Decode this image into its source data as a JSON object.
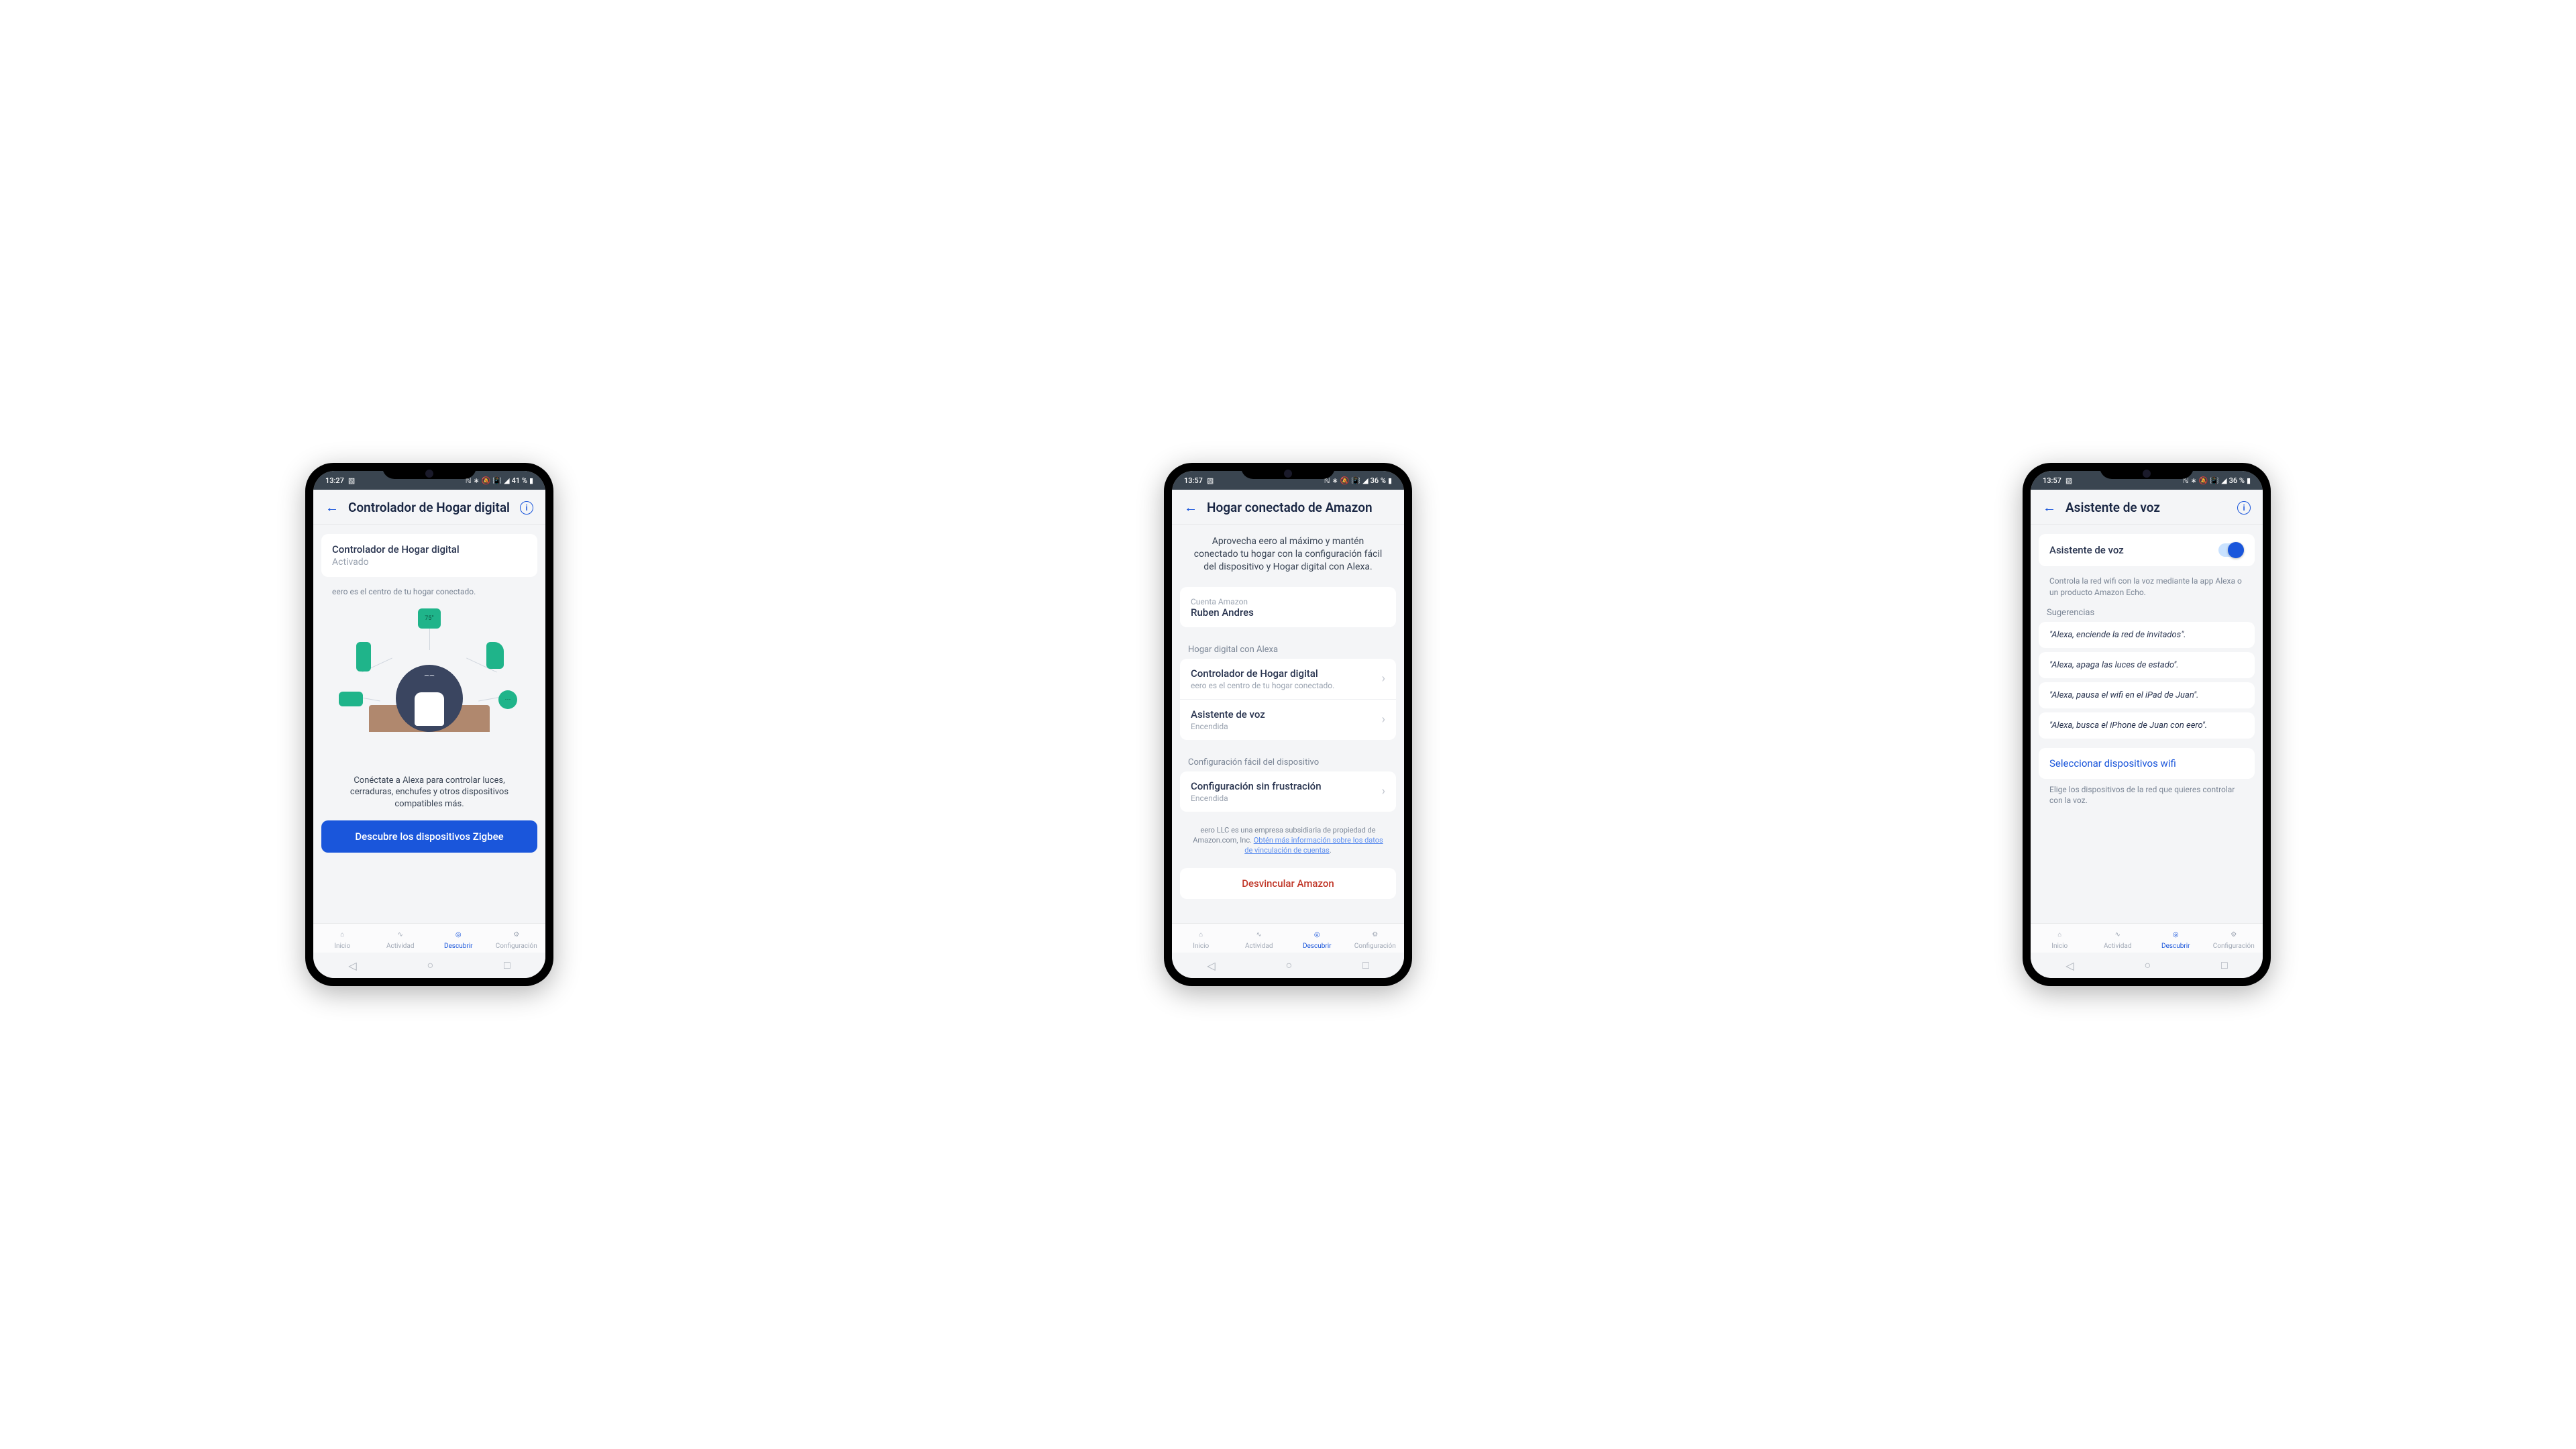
{
  "status": {
    "time1": "13:27",
    "time2": "13:57",
    "time3": "13:57",
    "battery1": "41 %",
    "battery2": "36 %",
    "battery3": "36 %"
  },
  "nav": {
    "inicio": "Inicio",
    "actividad": "Actividad",
    "descubrir": "Descubrir",
    "configuracion": "Configuración"
  },
  "phone1": {
    "title": "Controlador de Hogar digital",
    "card_title": "Controlador de Hogar digital",
    "card_sub": "Activado",
    "helper": "eero es el centro de tu hogar conectado.",
    "illu_temp": "75°",
    "desc": "Conéctate a Alexa para controlar luces, cerraduras, enchufes y otros dispositivos compatibles más.",
    "cta": "Descubre los dispositivos Zigbee"
  },
  "phone2": {
    "title": "Hogar conectado de Amazon",
    "intro": "Aprovecha eero al máximo y mantén conectado tu hogar con la configuración fácil del dispositivo y Hogar digital con Alexa.",
    "account_label": "Cuenta Amazon",
    "account_name": "Ruben Andres",
    "section_alexa": "Hogar digital con Alexa",
    "item1_title": "Controlador de Hogar digital",
    "item1_sub": "eero es el centro de tu hogar conectado.",
    "item2_title": "Asistente de voz",
    "item2_sub": "Encendida",
    "section_config": "Configuración fácil del dispositivo",
    "item3_title": "Configuración sin frustración",
    "item3_sub": "Encendida",
    "legal_prefix": "eero LLC es una empresa subsidiaria de propiedad de Amazon.com, Inc. ",
    "legal_link": "Obtén más información sobre los datos de vinculación de cuentas",
    "legal_suffix": ".",
    "unlink": "Desvincular Amazon"
  },
  "phone3": {
    "title": "Asistente de voz",
    "toggle_label": "Asistente de voz",
    "desc": "Controla la red wifi con la voz mediante la app Alexa o un producto Amazon Echo.",
    "section": "Sugerencias",
    "s1": "\"Alexa, enciende la red de invitados\".",
    "s2": "\"Alexa, apaga las luces de estado\".",
    "s3": "\"Alexa, pausa el wifi en el iPad de Juan\".",
    "s4": "\"Alexa, busca el iPhone de Juan con eero\".",
    "select": "Seleccionar dispositivos wifi",
    "footer": "Elige los dispositivos de la red que quieres controlar con la voz."
  }
}
